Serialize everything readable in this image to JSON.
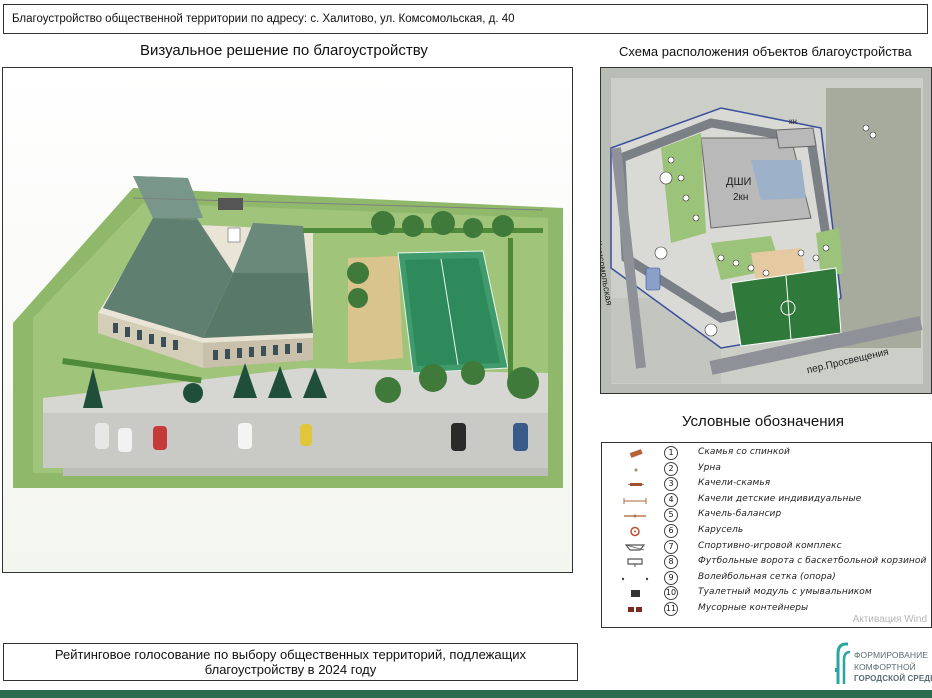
{
  "header": {
    "title": "Благоустройство  общественной территории по адресу: с. Халитово, ул. Комсомольская, д. 40"
  },
  "visual": {
    "heading": "Визуальное решение по благоустройству"
  },
  "scheme": {
    "heading": "Схема расположения  объектов благоустройства",
    "labels": {
      "building": "ДШИ",
      "floors": "2кн",
      "kn": "кн",
      "street_main": "ул.Комсомольская",
      "street_lane": "пер.Просвещения"
    }
  },
  "legend": {
    "heading": "Условные обозначения",
    "items": [
      {
        "num": "1",
        "label": "Скамья со спинкой",
        "icon": "bench-icon",
        "color": "#b5643a"
      },
      {
        "num": "2",
        "label": "Урна",
        "icon": "urn-icon",
        "color": "#9a8a7a"
      },
      {
        "num": "3",
        "label": "Качели-скамья",
        "icon": "swing-bench-icon",
        "color": "#a0522d"
      },
      {
        "num": "4",
        "label": "Качели детские индивидуальные",
        "icon": "kids-swing-icon",
        "color": "#b06a3b"
      },
      {
        "num": "5",
        "label": "Качель-балансир",
        "icon": "balance-swing-icon",
        "color": "#b87850"
      },
      {
        "num": "6",
        "label": "Карусель",
        "icon": "carousel-icon",
        "color": "#c0502d"
      },
      {
        "num": "7",
        "label": "Спортивно-игровой комплекс",
        "icon": "sport-complex-icon",
        "color": "#555555"
      },
      {
        "num": "8",
        "label": "Футбольные ворота с баскетбольной корзиной",
        "icon": "goal-icon",
        "color": "#555555"
      },
      {
        "num": "9",
        "label": "Волейбольная сетка (опора)",
        "icon": "volleyball-net-icon",
        "color": "#444444"
      },
      {
        "num": "10",
        "label": "Туалетный модуль с умывальником",
        "icon": "toilet-module-icon",
        "color": "#333333"
      },
      {
        "num": "11",
        "label": "Мусорные контейнеры",
        "icon": "trash-container-icon",
        "color": "#7a2a20"
      }
    ],
    "watermark": "Активация Wind"
  },
  "footer": {
    "vote_line1": "Рейтинговое голосование по выбору общественных территорий, подлежащих",
    "vote_line2": "благоустройству в 2024 году",
    "logo_line1": "ФОРМИРОВАНИЕ",
    "logo_line2": "КОМФОРТНОЙ",
    "logo_line3": "ГОРОДСКОЙ СРЕДЫ"
  },
  "colors": {
    "bottom_bar": "#2b6b4e",
    "roof": "#5a7a6a",
    "field": "#2e8a5a",
    "grass": "#7fae5a",
    "scheme_field": "#2f7a3a"
  }
}
